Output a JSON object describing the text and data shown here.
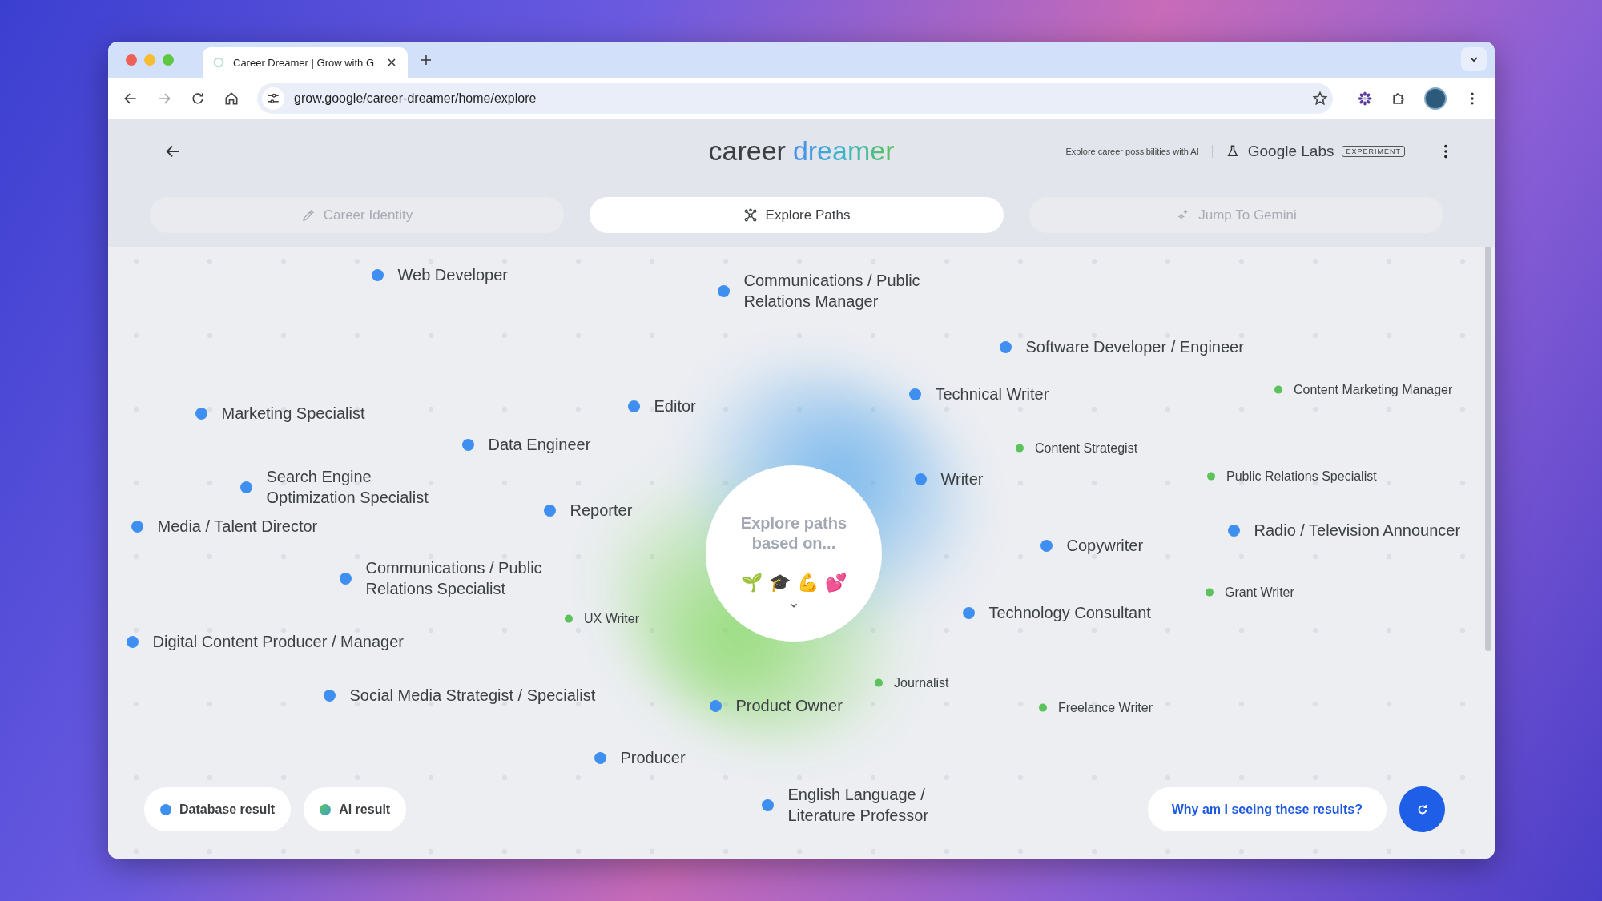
{
  "browser": {
    "tab": {
      "title": "Career Dreamer | Grow with G",
      "selected": true
    },
    "address": "grow.google/career-dreamer/home/explore"
  },
  "header": {
    "logo_first": "career",
    "logo_second": "dreamer",
    "tagline": "Explore career possibilities with AI",
    "labs": "Google Labs",
    "badge": "EXPERIMENT"
  },
  "tabs": [
    {
      "label": "Career Identity",
      "selected": false
    },
    {
      "label": "Explore Paths",
      "selected": true
    },
    {
      "label": "Jump To Gemini",
      "selected": false
    }
  ],
  "hub": {
    "text": "Explore paths based on...",
    "emojis": [
      "🌱",
      "🎓",
      "💪",
      "💕"
    ]
  },
  "paths": [
    {
      "label": "Web Developer",
      "kind": "database"
    },
    {
      "label": "Communications / Public Relations Manager",
      "kind": "database"
    },
    {
      "label": "Software Developer / Engineer",
      "kind": "database"
    },
    {
      "label": "Technical Writer",
      "kind": "database"
    },
    {
      "label": "Content Marketing Manager",
      "kind": "ai"
    },
    {
      "label": "Marketing Specialist",
      "kind": "database"
    },
    {
      "label": "Editor",
      "kind": "database"
    },
    {
      "label": "Data Engineer",
      "kind": "database"
    },
    {
      "label": "Content Strategist",
      "kind": "ai"
    },
    {
      "label": "Search Engine Optimization Specialist",
      "kind": "database"
    },
    {
      "label": "Writer",
      "kind": "database"
    },
    {
      "label": "Public Relations Specialist",
      "kind": "ai"
    },
    {
      "label": "Reporter",
      "kind": "database"
    },
    {
      "label": "Media / Talent Director",
      "kind": "database"
    },
    {
      "label": "Radio / Television Announcer",
      "kind": "database"
    },
    {
      "label": "Copywriter",
      "kind": "database"
    },
    {
      "label": "Communications / Public Relations Specialist",
      "kind": "database"
    },
    {
      "label": "Grant Writer",
      "kind": "ai"
    },
    {
      "label": "UX Writer",
      "kind": "ai"
    },
    {
      "label": "Technology Consultant",
      "kind": "database"
    },
    {
      "label": "Digital Content Producer / Manager",
      "kind": "database"
    },
    {
      "label": "Journalist",
      "kind": "ai"
    },
    {
      "label": "Social Media Strategist / Specialist",
      "kind": "database"
    },
    {
      "label": "Product Owner",
      "kind": "database"
    },
    {
      "label": "Freelance Writer",
      "kind": "ai"
    },
    {
      "label": "Producer",
      "kind": "database"
    },
    {
      "label": "English Language / Literature Professor",
      "kind": "database"
    }
  ],
  "legend": [
    {
      "label": "Database result",
      "kind": "database"
    },
    {
      "label": "AI result",
      "kind": "ai"
    }
  ],
  "why_button": "Why am I seeing these results?"
}
